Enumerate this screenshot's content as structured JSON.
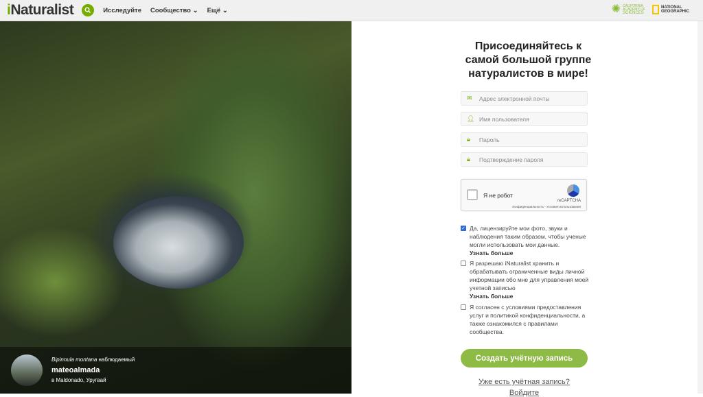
{
  "header": {
    "logo_prefix": "i",
    "logo_rest": "Naturalist",
    "nav": [
      {
        "label": "Исследуйте"
      },
      {
        "label": "Сообщество ⌄"
      },
      {
        "label": "Ещё ⌄"
      }
    ],
    "partners": {
      "cas": [
        "CALIFORNIA",
        "ACADEMY OF",
        "SCIENCES"
      ],
      "ng": [
        "NATIONAL",
        "GEOGRAPHIC"
      ]
    }
  },
  "photo": {
    "taxon": "Bipinnula montana",
    "observed": "наблюдаемый",
    "user": "mateoalmada",
    "place": "в Maldonado, Уругвай"
  },
  "form": {
    "title": "Присоединяйтесь к самой большой группе натуралистов в мире!",
    "fields": [
      {
        "icon": "envelope-icon",
        "placeholder": "Адрес электронной почты"
      },
      {
        "icon": "user-icon",
        "placeholder": "Имя пользователя"
      },
      {
        "icon": "lock-icon",
        "placeholder": "Пароль"
      },
      {
        "icon": "lock-icon",
        "placeholder": "Подтверждение пароля"
      }
    ],
    "captcha": {
      "label": "Я не робот",
      "brand": "reCAPTCHA",
      "links": "Конфиденциальность - Условия использования"
    },
    "checks": [
      {
        "checked": true,
        "text": "Да, лицензируйте мои фото, звуки и наблюдения таким образом, чтобы ученые могли использовать мои данные.",
        "link": "Узнать больше"
      },
      {
        "checked": false,
        "text": "Я разрешаю iNaturalist хранить и обрабатывать ограниченные виды личной информации обо мне для управления моей учетной записью",
        "link": "Узнать больше"
      },
      {
        "checked": false,
        "text": "Я согласен с условиями предоставления услуг и политикой конфиденциальности, а также ознакомился с правилами сообщества.",
        "link": ""
      }
    ],
    "submit": "Создать учётную запись",
    "have_account": "Уже есть учётная запись?",
    "login": "Войдите"
  },
  "colors": {
    "brand": "#74ac00",
    "button": "#8dbb45"
  }
}
